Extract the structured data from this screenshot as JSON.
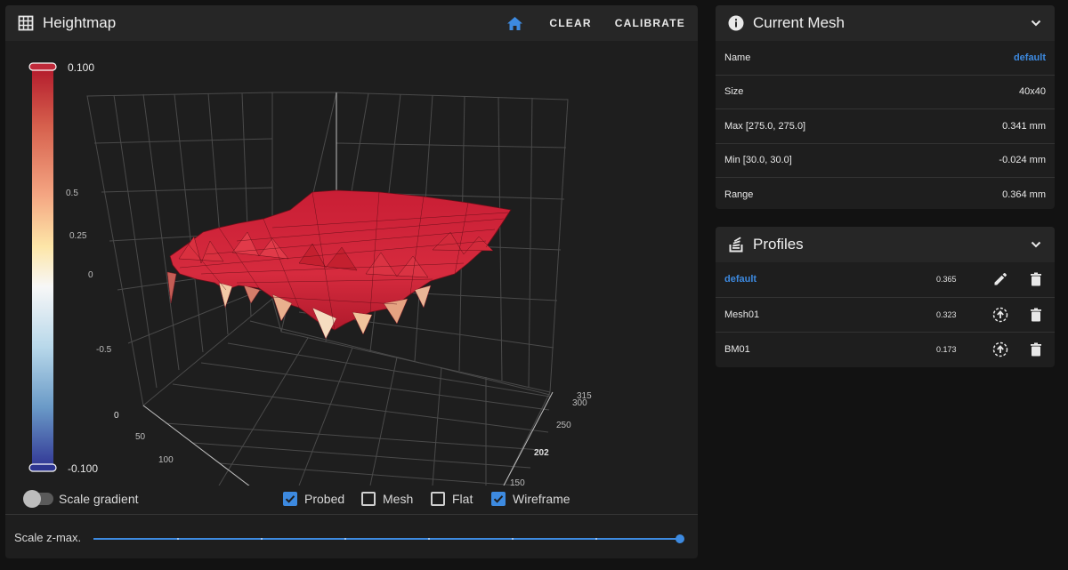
{
  "heightmap": {
    "title": "Heightmap",
    "actions": {
      "clear": "CLEAR",
      "calibrate": "CALIBRATE"
    },
    "colorbar": {
      "max_label": "0.100",
      "min_label": "-0.100"
    },
    "z_ticks": [
      "0.5",
      "0.25",
      "0",
      "-0.5"
    ],
    "x_ticks": [
      "0",
      "50",
      "100"
    ],
    "y_ticks": [
      "315",
      "300",
      "250",
      "202",
      "150"
    ],
    "controls": {
      "scale_gradient": "Scale gradient",
      "probed": "Probed",
      "mesh": "Mesh",
      "flat": "Flat",
      "wireframe": "Wireframe",
      "probed_checked": true,
      "mesh_checked": false,
      "flat_checked": false,
      "wireframe_checked": true,
      "scale_gradient_on": false
    },
    "scale_zmax": {
      "label": "Scale z-max.",
      "value_fraction": 1.0
    }
  },
  "current_mesh": {
    "title": "Current Mesh",
    "rows": [
      {
        "label": "Name",
        "value": "default"
      },
      {
        "label": "Size",
        "value": "40x40"
      },
      {
        "label": "Max [275.0, 275.0]",
        "value": "0.341 mm"
      },
      {
        "label": "Min [30.0, 30.0]",
        "value": "-0.024 mm"
      },
      {
        "label": "Range",
        "value": "0.364 mm"
      }
    ]
  },
  "profiles": {
    "title": "Profiles",
    "items": [
      {
        "name": "default",
        "value": "0.365",
        "active": true
      },
      {
        "name": "Mesh01",
        "value": "0.323",
        "active": false
      },
      {
        "name": "BM01",
        "value": "0.173",
        "active": false
      }
    ]
  },
  "colors": {
    "accent": "#3d8ae0",
    "surface": "#d0273a",
    "surface_dark": "#8e1a26",
    "surface_light": "#f5d9c0"
  },
  "icons": {
    "heightmap": "grid-icon",
    "home": "home-icon",
    "mesh": "info-icon",
    "profiles": "stack-icon",
    "collapse": "chevron-down-icon",
    "edit": "pencil-icon",
    "load": "upload-circle-icon",
    "delete": "trash-icon"
  }
}
